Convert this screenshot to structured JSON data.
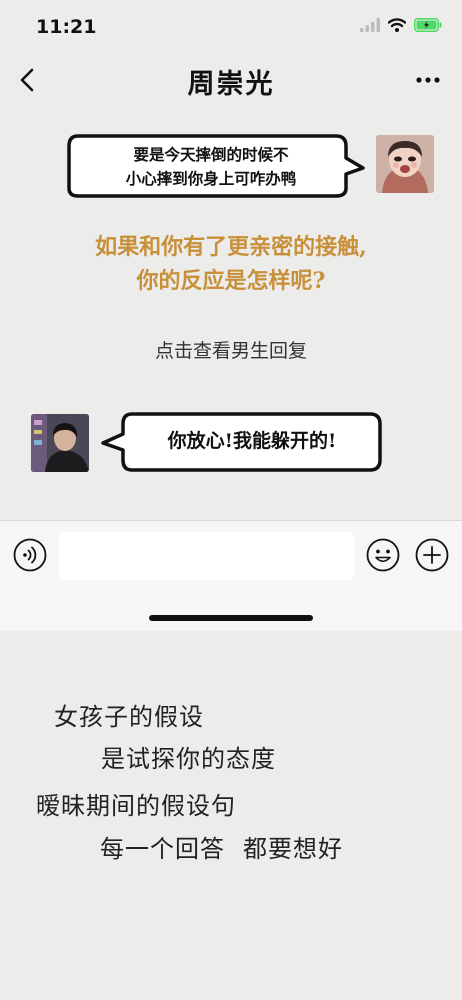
{
  "status_bar": {
    "time": "11:21",
    "battery_color": "#4cd964",
    "icons": [
      "signal-icon",
      "wifi-icon",
      "battery-charging-icon"
    ]
  },
  "nav": {
    "title": "周崇光",
    "back_icon": "chevron-left-icon",
    "more_icon": "more-dots-icon"
  },
  "chat": {
    "girl_message": {
      "line1": "要是今天摔倒的时候不",
      "line2": "小心摔到你身上可咋办鸭"
    },
    "question": {
      "line1": "如果和你有了更亲密的接触,",
      "line2": "你的反应是怎样呢?",
      "color": "#c9903a"
    },
    "reply_hint": "点击查看男生回复",
    "boy_message": "你放心!我能躲开的!"
  },
  "input_bar": {
    "value": "",
    "icons": [
      "voice-icon",
      "emoji-icon",
      "plus-icon"
    ]
  },
  "caption": {
    "line1": "女孩子的假设",
    "line2": "是试探你的态度",
    "line3": "暧昧期间的假设句",
    "line4_a": "每一个回答",
    "line4_b": "都要想好"
  }
}
